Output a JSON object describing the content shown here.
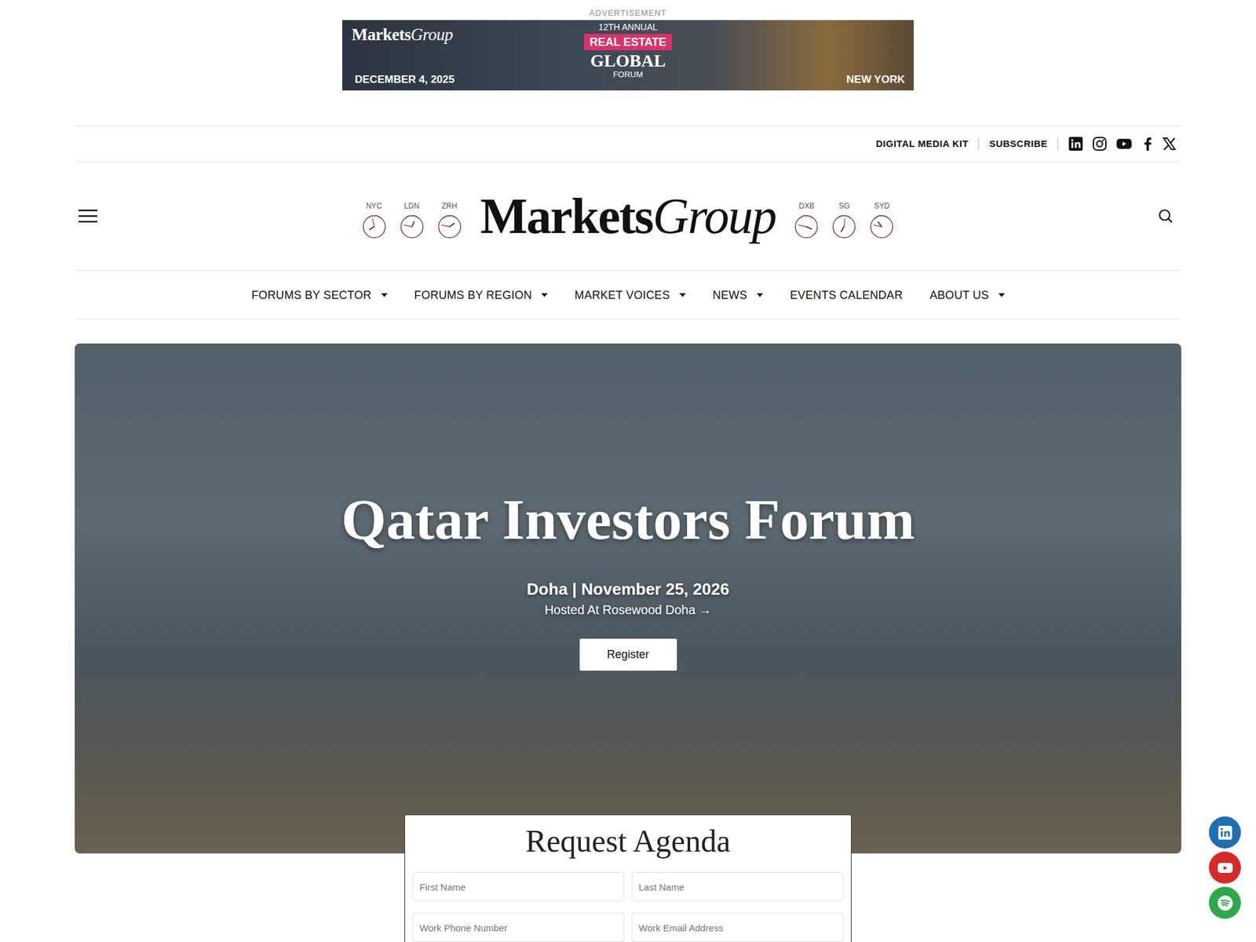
{
  "ad": {
    "label": "ADVERTISEMENT",
    "brand_bold": "Markets",
    "brand_italic": "Group",
    "edition": "12TH ANNUAL",
    "badge": "REAL ESTATE",
    "title": "GLOBAL",
    "subtitle": "FORUM",
    "date": "DECEMBER 4, 2025",
    "city": "NEW YORK"
  },
  "topbar": {
    "links": [
      "DIGITAL MEDIA KIT",
      "SUBSCRIBE"
    ]
  },
  "logo": {
    "bold": "Markets",
    "italic": "Group"
  },
  "clocks_left": [
    {
      "label": "NYC",
      "hour": 7,
      "minute": 58
    },
    {
      "label": "LDN",
      "hour": 12,
      "minute": 47
    },
    {
      "label": "ZRH",
      "hour": 1,
      "minute": 47
    }
  ],
  "clocks_right": [
    {
      "label": "DXB",
      "hour": 3,
      "minute": 47
    },
    {
      "label": "SG",
      "hour": 7,
      "minute": 1
    },
    {
      "label": "SYD",
      "hour": 10,
      "minute": 47
    }
  ],
  "nav": [
    {
      "label": "FORUMS BY SECTOR",
      "dropdown": true
    },
    {
      "label": "FORUMS BY REGION",
      "dropdown": true
    },
    {
      "label": "MARKET VOICES",
      "dropdown": true
    },
    {
      "label": "NEWS",
      "dropdown": true
    },
    {
      "label": "EVENTS CALENDAR",
      "dropdown": false
    },
    {
      "label": "ABOUT US",
      "dropdown": true
    }
  ],
  "hero": {
    "title": "Qatar Investors Forum",
    "location_date": "Doha | November 25, 2026",
    "venue": "Hosted At Rosewood Doha →",
    "button": "Register"
  },
  "form": {
    "title": "Request Agenda",
    "fields": [
      {
        "placeholder": "First Name"
      },
      {
        "placeholder": "Last Name"
      },
      {
        "placeholder": "Work Phone Number"
      },
      {
        "placeholder": "Work Email Address"
      }
    ]
  }
}
